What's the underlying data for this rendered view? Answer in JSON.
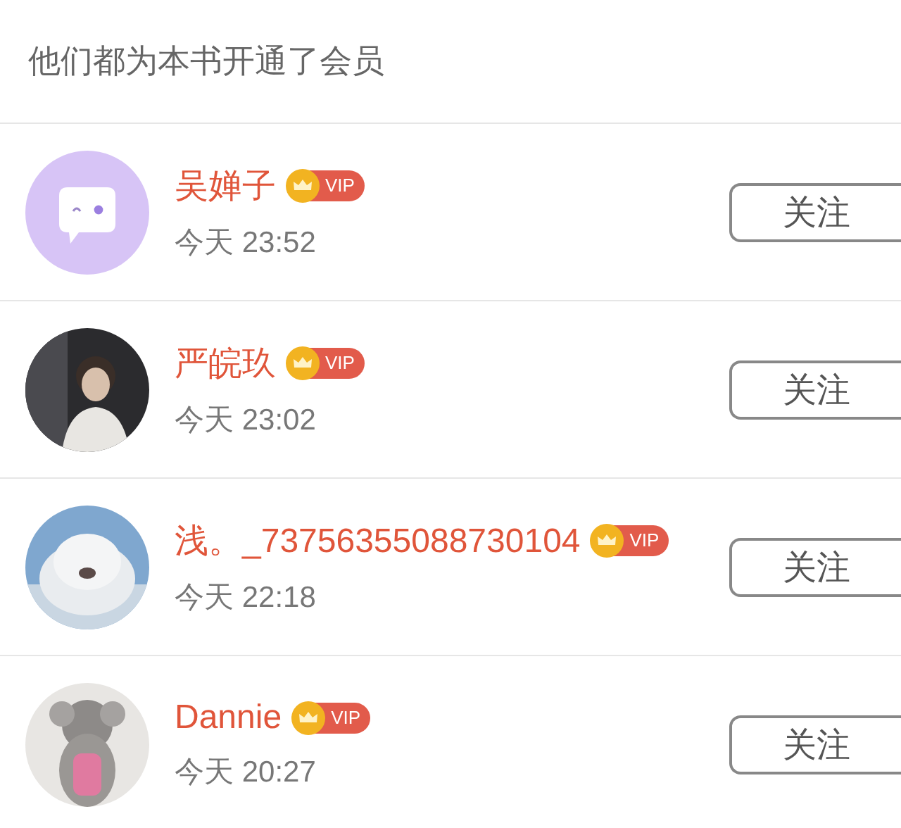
{
  "header": {
    "title": "他们都为本书开通了会员"
  },
  "members": [
    {
      "avatar": {
        "kind": "icon"
      },
      "name": "吴婵子",
      "badge": "VIP",
      "time": "今天 23:52",
      "button": "关注"
    },
    {
      "name": "严皖玖",
      "badge": "VIP",
      "time": "今天 23:02",
      "button": "关注"
    },
    {
      "name": "浅。_73756355088730104",
      "badge": "VIP",
      "time": "今天 22:18",
      "button": "关注"
    },
    {
      "name": "Dannie",
      "badge": "VIP",
      "time": "今天 20:27",
      "button": "关注"
    }
  ]
}
